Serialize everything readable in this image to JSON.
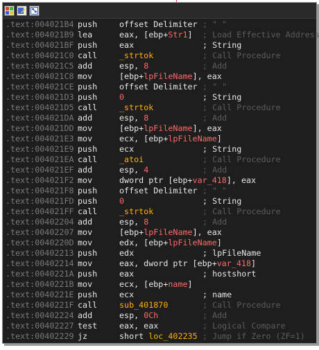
{
  "header": {
    "icons": [
      "color-palette-icon",
      "edit-graph-icon",
      "graph-overview-icon"
    ]
  },
  "colors": {
    "background": "#1e1e1e",
    "address": "#7a7a7a",
    "text": "#e8e8e8",
    "symbol": "#ff6a6a",
    "function": "#ffb000",
    "comment": "#5c5c5c",
    "edge": "#d83a3a"
  },
  "lines": [
    {
      "addr": ".text:004021B4",
      "mn": "push",
      "ops": [
        {
          "t": "offset ",
          "c": "kw"
        },
        {
          "t": "Delimiter",
          "c": "kw"
        }
      ],
      "cmt": "; \" \"",
      "cmtBright": false
    },
    {
      "addr": ".text:004021B9",
      "mn": "lea",
      "ops": [
        {
          "t": "eax, [ebp+",
          "c": "kw"
        },
        {
          "t": "Str1",
          "c": "sym"
        },
        {
          "t": "]",
          "c": "kw"
        }
      ],
      "cmt": "; Load Effective Address",
      "cmtBright": false
    },
    {
      "addr": ".text:004021BF",
      "mn": "push",
      "ops": [
        {
          "t": "eax",
          "c": "kw"
        }
      ],
      "cmt": "; String",
      "cmtBright": true
    },
    {
      "addr": ".text:004021C0",
      "mn": "call",
      "ops": [
        {
          "t": "_strtok",
          "c": "fn"
        }
      ],
      "cmt": "; Call Procedure",
      "cmtBright": false
    },
    {
      "addr": ".text:004021C5",
      "mn": "add",
      "ops": [
        {
          "t": "esp, ",
          "c": "kw"
        },
        {
          "t": "8",
          "c": "num"
        }
      ],
      "cmt": "; Add",
      "cmtBright": false
    },
    {
      "addr": ".text:004021C8",
      "mn": "mov",
      "ops": [
        {
          "t": "[ebp+",
          "c": "kw"
        },
        {
          "t": "lpFileName",
          "c": "sym"
        },
        {
          "t": "], eax",
          "c": "kw"
        }
      ],
      "cmt": "",
      "cmtBright": false
    },
    {
      "addr": ".text:004021CE",
      "mn": "push",
      "ops": [
        {
          "t": "offset ",
          "c": "kw"
        },
        {
          "t": "Delimiter",
          "c": "kw"
        }
      ],
      "cmt": "; \" \"",
      "cmtBright": false
    },
    {
      "addr": ".text:004021D3",
      "mn": "push",
      "ops": [
        {
          "t": "0",
          "c": "num"
        }
      ],
      "cmt": "; String",
      "cmtBright": true
    },
    {
      "addr": ".text:004021D5",
      "mn": "call",
      "ops": [
        {
          "t": "_strtok",
          "c": "fn"
        }
      ],
      "cmt": "; Call Procedure",
      "cmtBright": false
    },
    {
      "addr": ".text:004021DA",
      "mn": "add",
      "ops": [
        {
          "t": "esp, ",
          "c": "kw"
        },
        {
          "t": "8",
          "c": "num"
        }
      ],
      "cmt": "; Add",
      "cmtBright": false
    },
    {
      "addr": ".text:004021DD",
      "mn": "mov",
      "ops": [
        {
          "t": "[ebp+",
          "c": "kw"
        },
        {
          "t": "lpFileName",
          "c": "sym"
        },
        {
          "t": "], eax",
          "c": "kw"
        }
      ],
      "cmt": "",
      "cmtBright": false
    },
    {
      "addr": ".text:004021E3",
      "mn": "mov",
      "ops": [
        {
          "t": "ecx, [ebp+",
          "c": "kw"
        },
        {
          "t": "lpFileName",
          "c": "sym"
        },
        {
          "t": "]",
          "c": "kw"
        }
      ],
      "cmt": "",
      "cmtBright": false
    },
    {
      "addr": ".text:004021E9",
      "mn": "push",
      "ops": [
        {
          "t": "ecx",
          "c": "kw"
        }
      ],
      "cmt": "; String",
      "cmtBright": true
    },
    {
      "addr": ".text:004021EA",
      "mn": "call",
      "ops": [
        {
          "t": "_atoi",
          "c": "fn"
        }
      ],
      "cmt": "; Call Procedure",
      "cmtBright": false
    },
    {
      "addr": ".text:004021EF",
      "mn": "add",
      "ops": [
        {
          "t": "esp, ",
          "c": "kw"
        },
        {
          "t": "4",
          "c": "num"
        }
      ],
      "cmt": "; Add",
      "cmtBright": false
    },
    {
      "addr": ".text:004021F2",
      "mn": "mov",
      "ops": [
        {
          "t": "dword ptr [ebp+",
          "c": "kw"
        },
        {
          "t": "var_418",
          "c": "sym"
        },
        {
          "t": "], eax",
          "c": "kw"
        }
      ],
      "cmt": "",
      "cmtBright": false
    },
    {
      "addr": ".text:004021F8",
      "mn": "push",
      "ops": [
        {
          "t": "offset ",
          "c": "kw"
        },
        {
          "t": "Delimiter",
          "c": "kw"
        }
      ],
      "cmt": "; \" \"",
      "cmtBright": false
    },
    {
      "addr": ".text:004021FD",
      "mn": "push",
      "ops": [
        {
          "t": "0",
          "c": "num"
        }
      ],
      "cmt": "; String",
      "cmtBright": true
    },
    {
      "addr": ".text:004021FF",
      "mn": "call",
      "ops": [
        {
          "t": "_strtok",
          "c": "fn"
        }
      ],
      "cmt": "; Call Procedure",
      "cmtBright": false
    },
    {
      "addr": ".text:00402204",
      "mn": "add",
      "ops": [
        {
          "t": "esp, ",
          "c": "kw"
        },
        {
          "t": "8",
          "c": "num"
        }
      ],
      "cmt": "; Add",
      "cmtBright": false
    },
    {
      "addr": ".text:00402207",
      "mn": "mov",
      "ops": [
        {
          "t": "[ebp+",
          "c": "kw"
        },
        {
          "t": "lpFileName",
          "c": "sym"
        },
        {
          "t": "], eax",
          "c": "kw"
        }
      ],
      "cmt": "",
      "cmtBright": false
    },
    {
      "addr": ".text:0040220D",
      "mn": "mov",
      "ops": [
        {
          "t": "edx, [ebp+",
          "c": "kw"
        },
        {
          "t": "lpFileName",
          "c": "sym"
        },
        {
          "t": "]",
          "c": "kw"
        }
      ],
      "cmt": "",
      "cmtBright": false
    },
    {
      "addr": ".text:00402213",
      "mn": "push",
      "ops": [
        {
          "t": "edx",
          "c": "kw"
        }
      ],
      "cmt": "; lpFileName",
      "cmtBright": true
    },
    {
      "addr": ".text:00402214",
      "mn": "mov",
      "ops": [
        {
          "t": "eax, dword ptr [ebp+",
          "c": "kw"
        },
        {
          "t": "var_418",
          "c": "sym"
        },
        {
          "t": "]",
          "c": "kw"
        }
      ],
      "cmt": "",
      "cmtBright": false
    },
    {
      "addr": ".text:0040221A",
      "mn": "push",
      "ops": [
        {
          "t": "eax",
          "c": "kw"
        }
      ],
      "cmt": "; hostshort",
      "cmtBright": true
    },
    {
      "addr": ".text:0040221B",
      "mn": "mov",
      "ops": [
        {
          "t": "ecx, [ebp+",
          "c": "kw"
        },
        {
          "t": "name",
          "c": "sym"
        },
        {
          "t": "]",
          "c": "kw"
        }
      ],
      "cmt": "",
      "cmtBright": false
    },
    {
      "addr": ".text:0040221E",
      "mn": "push",
      "ops": [
        {
          "t": "ecx",
          "c": "kw"
        }
      ],
      "cmt": "; name",
      "cmtBright": true
    },
    {
      "addr": ".text:0040221F",
      "mn": "call",
      "ops": [
        {
          "t": "sub_401870",
          "c": "fn"
        }
      ],
      "cmt": "; Call Procedure",
      "cmtBright": false
    },
    {
      "addr": ".text:00402224",
      "mn": "add",
      "ops": [
        {
          "t": "esp, ",
          "c": "kw"
        },
        {
          "t": "0Ch",
          "c": "num"
        }
      ],
      "cmt": "; Add",
      "cmtBright": false
    },
    {
      "addr": ".text:00402227",
      "mn": "test",
      "ops": [
        {
          "t": "eax, eax",
          "c": "kw"
        }
      ],
      "cmt": "; Logical Compare",
      "cmtBright": false
    },
    {
      "addr": ".text:00402229",
      "mn": "jz",
      "ops": [
        {
          "t": "short ",
          "c": "kw"
        },
        {
          "t": "loc_402235",
          "c": "fn"
        }
      ],
      "cmt": "; Jump if Zero (ZF=1)",
      "cmtBright": false
    }
  ]
}
